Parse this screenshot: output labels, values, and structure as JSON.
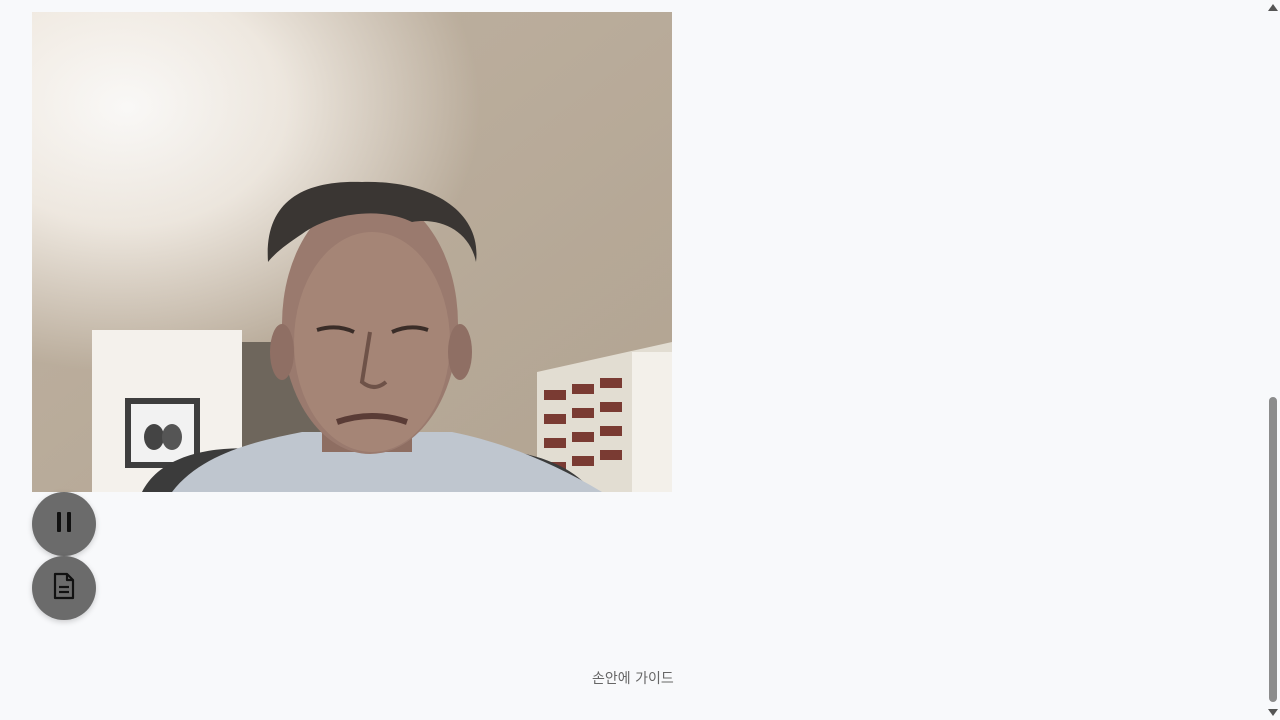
{
  "video": {
    "label": "camera-feed"
  },
  "controls": {
    "pause_icon": "pause-icon",
    "document_icon": "document-icon"
  },
  "footer": {
    "guide_link": "손안에 가이드"
  }
}
